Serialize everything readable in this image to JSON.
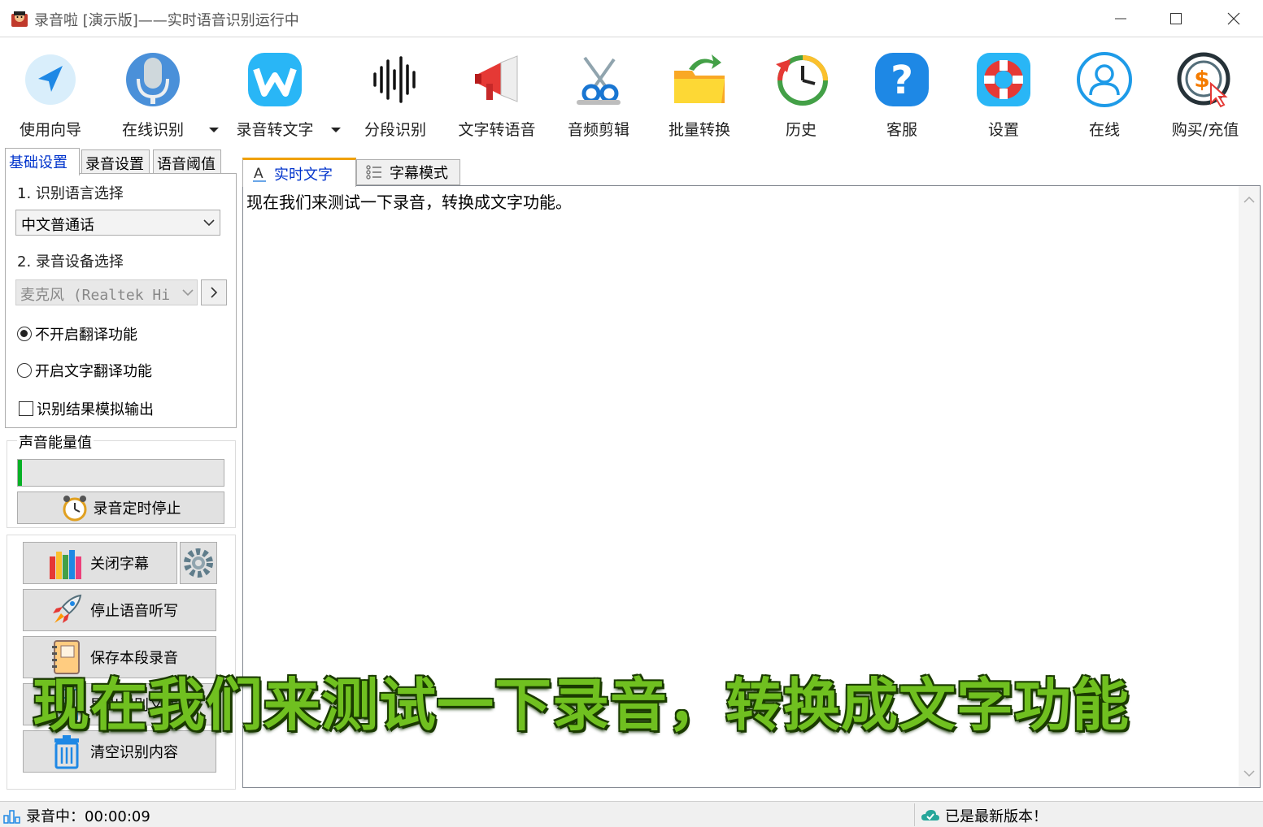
{
  "window": {
    "title": "录音啦 [演示版]——实时语音识别运行中"
  },
  "toolbar": {
    "items": [
      {
        "label": "使用向导",
        "icon": "navigation-arrow-icon"
      },
      {
        "label": "在线识别",
        "icon": "microphone-icon"
      },
      {
        "label": "录音转文字",
        "icon": "w-logo-icon"
      },
      {
        "label": "分段识别",
        "icon": "waveform-icon"
      },
      {
        "label": "文字转语音",
        "icon": "megaphone-icon"
      },
      {
        "label": "音频剪辑",
        "icon": "scissors-icon"
      },
      {
        "label": "批量转换",
        "icon": "folder-arrow-icon"
      },
      {
        "label": "历史",
        "icon": "history-clock-icon"
      },
      {
        "label": "客服",
        "icon": "question-icon"
      },
      {
        "label": "设置",
        "icon": "lifebuoy-icon"
      },
      {
        "label": "在线",
        "icon": "user-circle-icon"
      },
      {
        "label": "购买/充值",
        "icon": "dollar-cursor-icon"
      }
    ]
  },
  "left_tabs": [
    "基础设置",
    "录音设置",
    "语音阈值"
  ],
  "basic": {
    "lang_label": "1. 识别语言选择",
    "lang_value": "中文普通话",
    "device_label": "2. 录音设备选择",
    "device_value": "麦克风 (Realtek Hi",
    "no_translate": "不开启翻译功能",
    "translate": "开启文字翻译功能",
    "simulate_output": "识别结果模拟输出"
  },
  "energy": {
    "title": "声音能量值",
    "level_fraction": 0.01,
    "timer_button": "录音定时停止"
  },
  "actions": {
    "close_subtitle": "关闭字幕",
    "stop_dictation": "停止语音听写",
    "save_segment": "保存本段录音",
    "export_text": "导出识别文本",
    "clear": "清空识别内容"
  },
  "right_tabs": [
    "实时文字",
    "字幕模式"
  ],
  "content": {
    "recognized_text": "现在我们来测试一下录音，转换成文字功能。",
    "subtitle_overlay": "现在我们来测试一下录音，转换成文字功能"
  },
  "status": {
    "recording": "录音中：00:00:09",
    "version": "已是最新版本！"
  },
  "colors": {
    "accent_blue": "#0033cc",
    "subtitle_green": "#70c020",
    "energy_green": "#06b025"
  }
}
